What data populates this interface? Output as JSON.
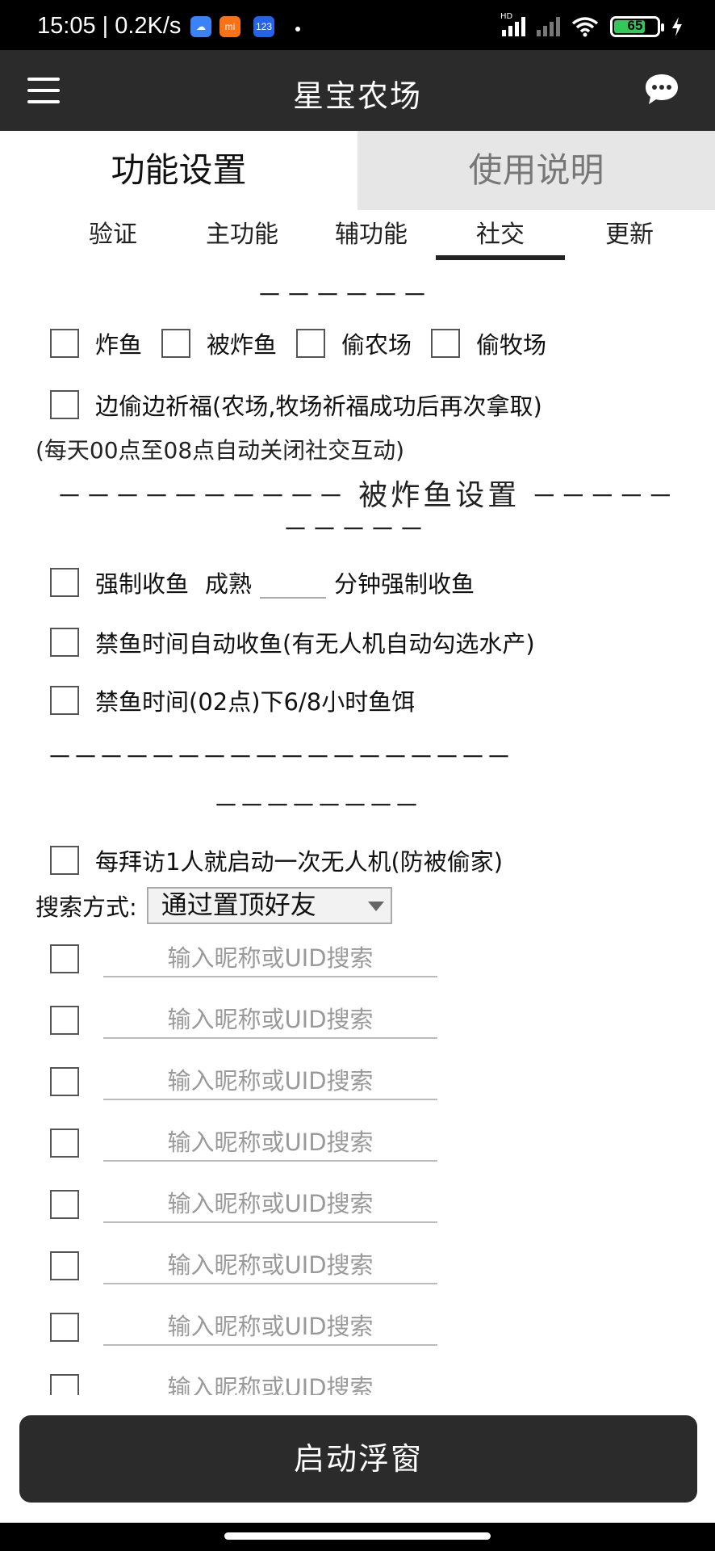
{
  "status_bar": {
    "time": "15:05 | 0.2K/s",
    "icons": [
      "cloud-app-icon",
      "mi-app-icon",
      "123-app-icon"
    ],
    "mi_label": "mi",
    "app123_label": "123",
    "battery": "65",
    "hd": "HD"
  },
  "app_bar": {
    "title": "星宝农场"
  },
  "main_tabs": [
    {
      "label": "功能设置"
    },
    {
      "label": "使用说明"
    }
  ],
  "sub_tabs": [
    {
      "label": "验证"
    },
    {
      "label": "主功能"
    },
    {
      "label": "辅功能"
    },
    {
      "label": "社交"
    },
    {
      "label": "更新"
    }
  ],
  "social": {
    "divider_top": "－－－－－－",
    "options1": [
      "炸鱼",
      "被炸鱼",
      "偷农场",
      "偷牧场"
    ],
    "steal_pray": "边偷边祈福(农场,牧场祈福成功后再次拿取)",
    "note": "(每天00点至08点自动关闭社交互动)",
    "bombed_divider_left": "－－－－－－－－－－",
    "bombed_title": "被炸鱼设置",
    "bombed_divider_right": "－－－－－",
    "bombed_divider_wrap": "－－－－－",
    "force_collect": "强制收鱼",
    "ripe_label": "成熟",
    "minutes_label": "分钟强制收鱼",
    "ban_auto_collect": "禁鱼时间自动收鱼(有无人机自动勾选水产)",
    "ban_bait": "禁鱼时间(02点)下6/8小时鱼饵",
    "long_divider": "－－－－－－－－－－－－－－－－－－",
    "long_divider_wrap": "－－－－－－－－",
    "drone_visit": "每拜访1人就启动一次无人机(防被偷家)",
    "search_label": "搜索方式:",
    "search_selected": "通过置顶好友",
    "uid_placeholder": "输入昵称或UID搜索"
  },
  "start_button": "启动浮窗"
}
